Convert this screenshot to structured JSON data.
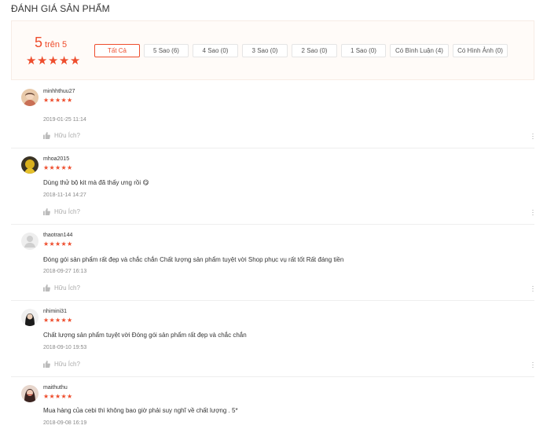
{
  "section_title": "ĐÁNH GIÁ SẢN PHẨM",
  "overview": {
    "score": "5",
    "score_suffix": "trên 5",
    "rating": 5,
    "filters": [
      {
        "label": "Tất Cả",
        "active": true
      },
      {
        "label": "5 Sao (6)",
        "active": false
      },
      {
        "label": "4 Sao (0)",
        "active": false
      },
      {
        "label": "3 Sao (0)",
        "active": false
      },
      {
        "label": "2 Sao (0)",
        "active": false
      },
      {
        "label": "1 Sao (0)",
        "active": false
      },
      {
        "label": "Có Bình Luận (4)",
        "active": false
      },
      {
        "label": "Có Hình Ảnh (0)",
        "active": false
      }
    ]
  },
  "reviews": [
    {
      "username": "minhhthuu27",
      "rating": 5,
      "comment": "",
      "date": "2019-01-25 11:14",
      "helpful": "Hữu Ích?"
    },
    {
      "username": "mhoa2015",
      "rating": 5,
      "comment": "Dùng thử bộ kit mà đã thấy ưng rồi 😋",
      "date": "2018-11-14 14:27",
      "helpful": "Hữu Ích?"
    },
    {
      "username": "thaotran144",
      "rating": 5,
      "comment": " Đóng gói sản phẩm rất đẹp và chắc chắn Chất lượng sản phẩm tuyệt vời Shop phục vụ rất tốt Rất đáng tiền",
      "date": "2018-09-27 16:13",
      "helpful": "Hữu Ích?"
    },
    {
      "username": "nhimini31",
      "rating": 5,
      "comment": " Chất lượng sản phẩm tuyệt vời Đóng gói sản phẩm rất đẹp và chắc chắn",
      "date": "2018-09-10 19:53",
      "helpful": "Hữu Ích?"
    },
    {
      "username": "maithuthu",
      "rating": 5,
      "comment": "Mua hàng của cebi thì không bao giờ phải suy nghĩ về chất lượng . 5*",
      "date": "2018-09-08 16:19",
      "helpful": "Hữu Ích?"
    }
  ],
  "colors": {
    "accent": "#ee4d2d"
  },
  "icons": {
    "star": "star-icon",
    "thumb": "thumbs-up-icon",
    "more": "more-options-icon"
  }
}
